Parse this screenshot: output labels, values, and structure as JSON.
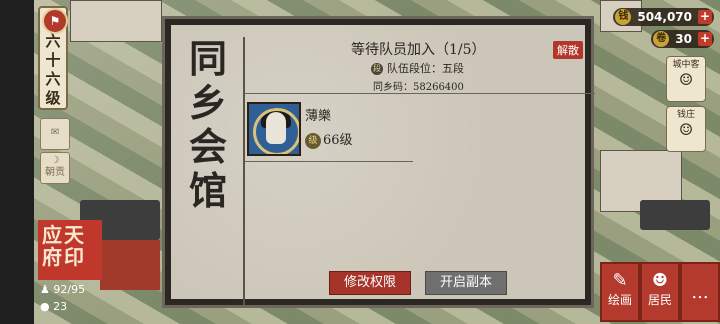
{
  "hud": {
    "level_text": "六十六级",
    "buttons": [
      {
        "label": "",
        "icon": "chat-icon"
      },
      {
        "label": "朝贡",
        "icon": "bow-icon"
      }
    ],
    "city": {
      "name": "应天府印",
      "population": "92/95",
      "counter": "23"
    },
    "resources": [
      {
        "value": "504,070",
        "icon": "coin-icon"
      },
      {
        "value": "30",
        "icon": "scroll-icon"
      }
    ],
    "right_cards": [
      {
        "label": "城中客",
        "icon": "guest-icon"
      },
      {
        "label": "钱庄",
        "icon": "bank-icon"
      }
    ],
    "bottom_buttons": [
      {
        "label": "绘画",
        "icon": "paint-icon"
      },
      {
        "label": "居民",
        "icon": "resident-icon"
      },
      {
        "label": "...",
        "icon": "more-icon"
      }
    ]
  },
  "dialog": {
    "title": "同乡会馆",
    "status": "等待队员加入（1/5）",
    "dissolve_label": "解散",
    "rank": "队伍段位：五段",
    "code": "同乡码：58266400",
    "members": [
      {
        "name": "薄樂",
        "level": "66级"
      }
    ],
    "modify_label": "修改权限",
    "start_label": "开启副本"
  }
}
